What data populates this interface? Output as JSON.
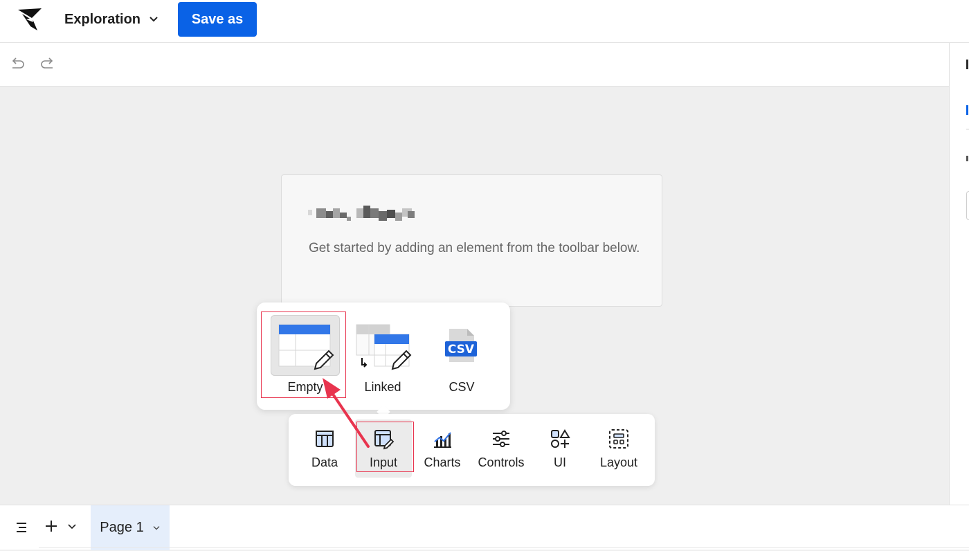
{
  "header": {
    "workbook_title": "Exploration",
    "save_button": "Save as"
  },
  "card": {
    "hint": "Get started by adding an element from the toolbar below."
  },
  "input_popover": {
    "items": [
      {
        "label": "Empty",
        "icon": "empty-table-edit-icon"
      },
      {
        "label": "Linked",
        "icon": "linked-table-edit-icon"
      },
      {
        "label": "CSV",
        "icon": "csv-file-icon"
      }
    ]
  },
  "toolbar": {
    "items": [
      {
        "label": "Data",
        "icon": "table-icon"
      },
      {
        "label": "Input",
        "icon": "input-table-icon"
      },
      {
        "label": "Charts",
        "icon": "chart-icon"
      },
      {
        "label": "Controls",
        "icon": "sliders-icon"
      },
      {
        "label": "UI",
        "icon": "shapes-icon"
      },
      {
        "label": "Layout",
        "icon": "layout-icon"
      }
    ]
  },
  "footer": {
    "page_tab": "Page 1"
  },
  "colors": {
    "accent": "#0a62e6",
    "highlight": "#e8344e",
    "canvas": "#efefef"
  }
}
